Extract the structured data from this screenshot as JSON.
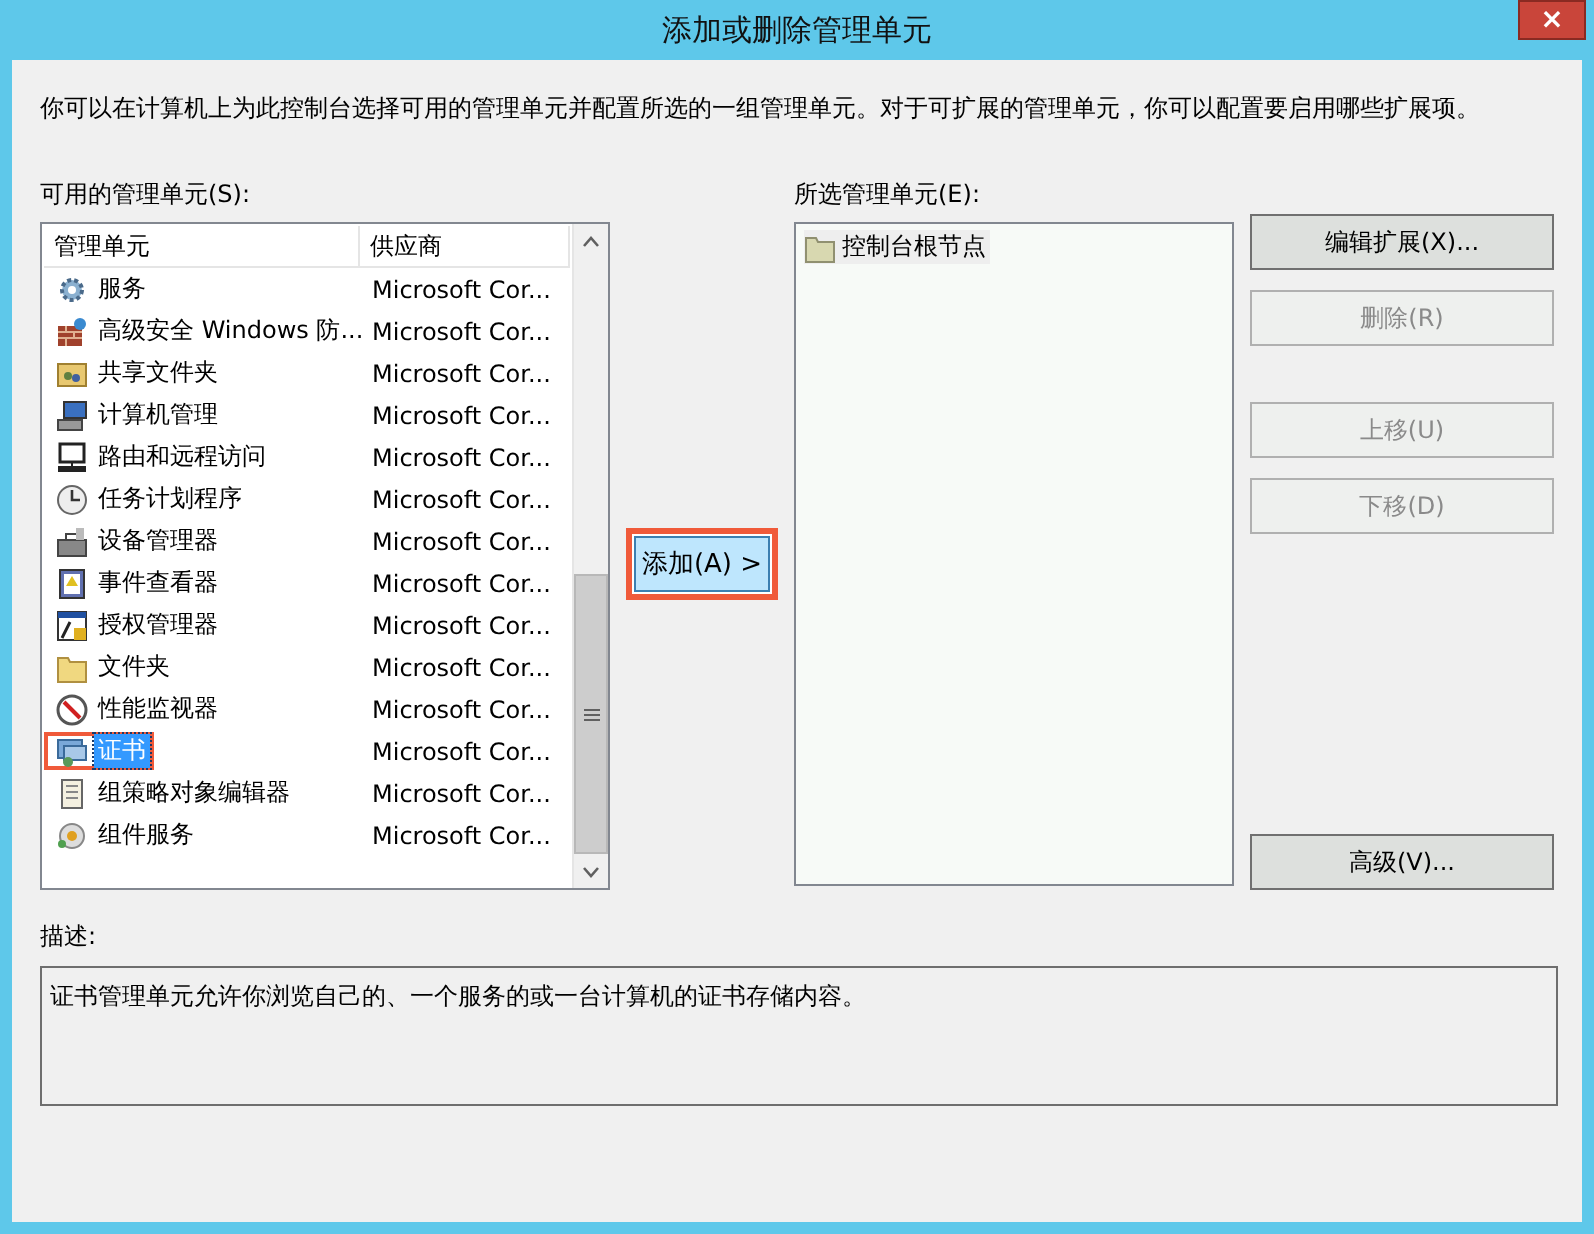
{
  "window": {
    "title": "添加或删除管理单元",
    "close": "×"
  },
  "intro": "你可以在计算机上为此控制台选择可用的管理单元并配置所选的一组管理单元。对于可扩展的管理单元，你可以配置要启用哪些扩展项。",
  "available": {
    "label": "可用的管理单元(S):",
    "columns": [
      "管理单元",
      "供应商"
    ],
    "rows": [
      {
        "name": "服务",
        "vendor": "Microsoft Cor...",
        "selected": false,
        "highlighted": false
      },
      {
        "name": "高级安全 Windows 防...",
        "vendor": "Microsoft Cor...",
        "selected": false,
        "highlighted": false
      },
      {
        "name": "共享文件夹",
        "vendor": "Microsoft Cor...",
        "selected": false,
        "highlighted": false
      },
      {
        "name": "计算机管理",
        "vendor": "Microsoft Cor...",
        "selected": false,
        "highlighted": false
      },
      {
        "name": "路由和远程访问",
        "vendor": "Microsoft Cor...",
        "selected": false,
        "highlighted": false
      },
      {
        "name": "任务计划程序",
        "vendor": "Microsoft Cor...",
        "selected": false,
        "highlighted": false
      },
      {
        "name": "设备管理器",
        "vendor": "Microsoft Cor...",
        "selected": false,
        "highlighted": false
      },
      {
        "name": "事件查看器",
        "vendor": "Microsoft Cor...",
        "selected": false,
        "highlighted": false
      },
      {
        "name": "授权管理器",
        "vendor": "Microsoft Cor...",
        "selected": false,
        "highlighted": false
      },
      {
        "name": "文件夹",
        "vendor": "Microsoft Cor...",
        "selected": false,
        "highlighted": false
      },
      {
        "name": "性能监视器",
        "vendor": "Microsoft Cor...",
        "selected": false,
        "highlighted": false
      },
      {
        "name": "证书",
        "vendor": "Microsoft Cor...",
        "selected": true,
        "highlighted": true
      },
      {
        "name": "组策略对象编辑器",
        "vendor": "Microsoft Cor...",
        "selected": false,
        "highlighted": false
      },
      {
        "name": "组件服务",
        "vendor": "Microsoft Cor...",
        "selected": false,
        "highlighted": false
      }
    ]
  },
  "add_button": {
    "label": "添加(A) >",
    "highlighted": true
  },
  "chosen": {
    "label": "所选管理单元(E):",
    "items": [
      {
        "name": "控制台根节点"
      }
    ]
  },
  "buttons": [
    {
      "label": "编辑扩展(X)...",
      "disabled": false
    },
    {
      "label": "删除(R)",
      "disabled": true
    },
    {
      "label": "上移(U)",
      "disabled": true
    },
    {
      "label": "下移(D)",
      "disabled": true
    },
    {
      "label": "高级(V)...",
      "disabled": false
    }
  ],
  "description": {
    "label": "描述:",
    "text": "证书管理单元允许你浏览自己的、一个服务的或一台计算机的证书存储内容。"
  }
}
